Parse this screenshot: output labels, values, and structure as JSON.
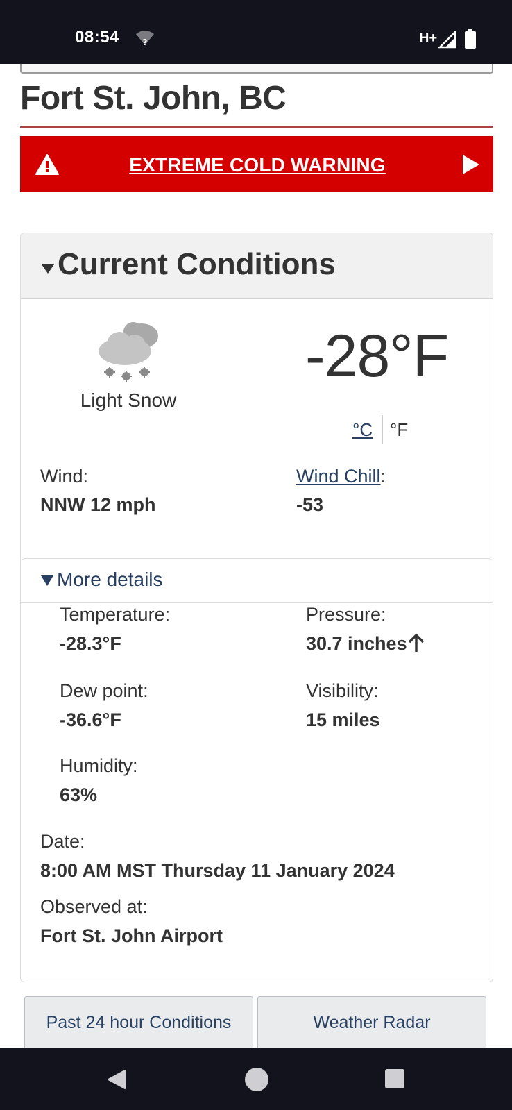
{
  "status_bar": {
    "time": "08:54",
    "network": "H+",
    "icons": [
      "wifi-question-icon",
      "cell-signal-icon",
      "battery-icon"
    ]
  },
  "page": {
    "city_title": "Fort St. John, BC"
  },
  "warning": {
    "text": "EXTREME COLD WARNING",
    "background": "#d40000",
    "icons": [
      "warning-triangle-icon",
      "play-arrow-icon"
    ]
  },
  "current_conditions": {
    "header": "Current Conditions",
    "condition": "Light Snow",
    "condition_icon": "light-snow-cloud-icon",
    "temperature": "-28°F",
    "unit_c": "°C",
    "unit_f": "°F",
    "wind_label": "Wind:",
    "wind_value": "NNW 12 mph",
    "wind_chill_link": "Wind Chill",
    "wind_chill_colon": ":",
    "wind_chill_value": "-53"
  },
  "more_details": {
    "toggle_label": "More details",
    "temperature_label": "Temperature:",
    "temperature_value": "-28.3°F",
    "pressure_label": "Pressure:",
    "pressure_value": "30.7 inches",
    "pressure_trend_icon": "arrow-up-icon",
    "dew_point_label": "Dew point:",
    "dew_point_value": "-36.6°F",
    "visibility_label": "Visibility:",
    "visibility_value": "15 miles",
    "humidity_label": "Humidity:",
    "humidity_value": "63%",
    "date_label": "Date:",
    "date_value": "8:00 AM MST Thursday 11 January 2024",
    "observed_label": "Observed at:",
    "observed_value": "Fort St. John Airport"
  },
  "buttons": {
    "past_24": "Past 24 hour Conditions",
    "radar": "Weather Radar"
  },
  "nav_bar": {
    "icons": [
      "back-icon",
      "home-icon",
      "recents-icon"
    ]
  },
  "colors": {
    "link": "#284162",
    "warning_red": "#d40000",
    "system_bar": "#13131d"
  }
}
